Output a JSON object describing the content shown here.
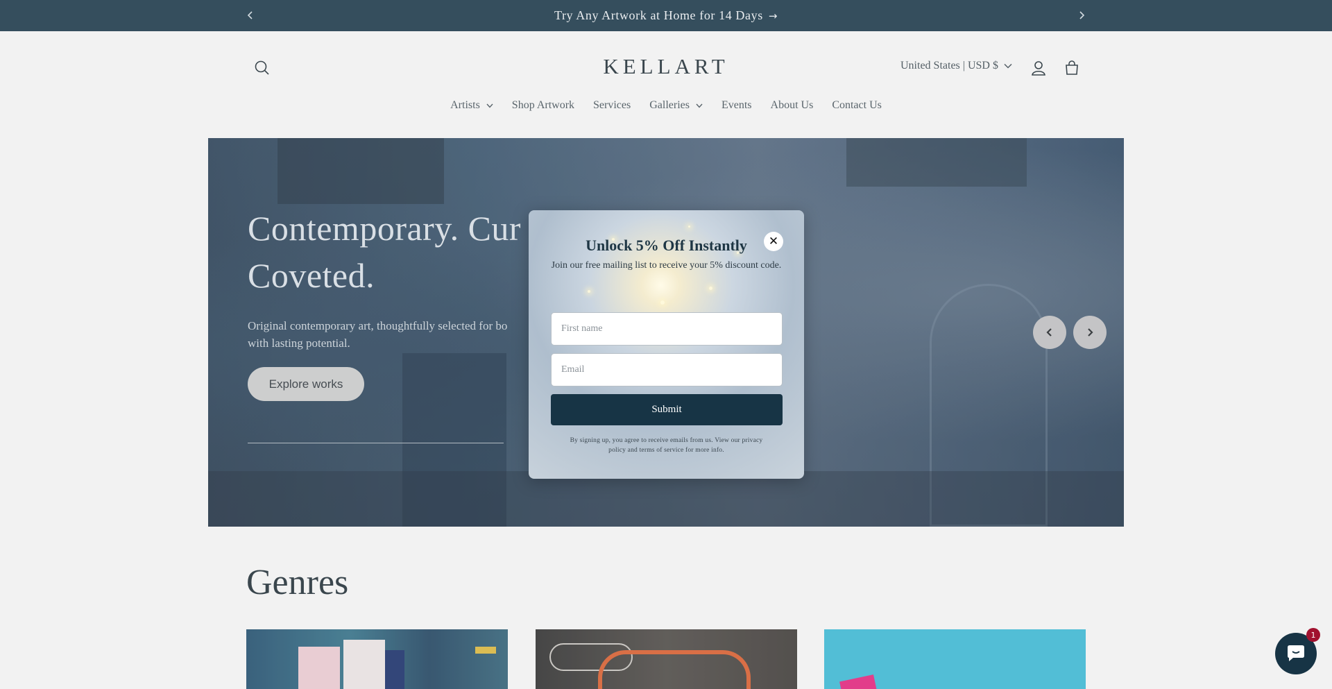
{
  "announcement": {
    "text": "Try Any Artwork at Home for 14 Days",
    "arrow": "→",
    "prev_icon": "chevron-left-icon",
    "next_icon": "chevron-right-icon"
  },
  "header": {
    "logo": "KELLART",
    "country_selector": "United States | USD $",
    "icons": [
      "search-icon",
      "account-icon",
      "cart-icon"
    ]
  },
  "nav": {
    "items": [
      {
        "label": "Artists",
        "has_dropdown": true
      },
      {
        "label": "Shop Artwork",
        "has_dropdown": false
      },
      {
        "label": "Services",
        "has_dropdown": false
      },
      {
        "label": "Galleries",
        "has_dropdown": true
      },
      {
        "label": "Events",
        "has_dropdown": false
      },
      {
        "label": "About Us",
        "has_dropdown": false
      },
      {
        "label": "Contact Us",
        "has_dropdown": false
      }
    ]
  },
  "hero": {
    "title_line1": "Contemporary. Cur",
    "title_line2": "Coveted.",
    "subtitle_line1": "Original contemporary art, thoughtfully selected for bo",
    "subtitle_line2": "with lasting potential.",
    "cta": "Explore works"
  },
  "genres": {
    "title": "Genres"
  },
  "popup": {
    "title": "Unlock 5% Off Instantly",
    "subtitle": "Join our free mailing list to receive your 5% discount code.",
    "first_name_placeholder": "First name",
    "email_placeholder": "Email",
    "first_name_value": "",
    "email_value": "",
    "submit": "Submit",
    "legal": "By signing up, you agree to receive emails from us. View our privacy policy and terms of service for more info.",
    "close": "✕"
  },
  "chat": {
    "badge_count": "1"
  },
  "colors": {
    "brand_dark": "#173445",
    "badge_red": "#a1112e"
  }
}
